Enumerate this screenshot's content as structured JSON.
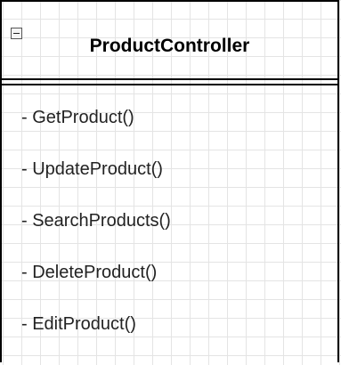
{
  "class_box": {
    "name": "ProductController",
    "toggle_icon": "collapse-minus-icon",
    "methods": [
      "- GetProduct()",
      "- UpdateProduct()",
      "- SearchProducts()",
      "- DeleteProduct()",
      "- EditProduct()"
    ]
  }
}
